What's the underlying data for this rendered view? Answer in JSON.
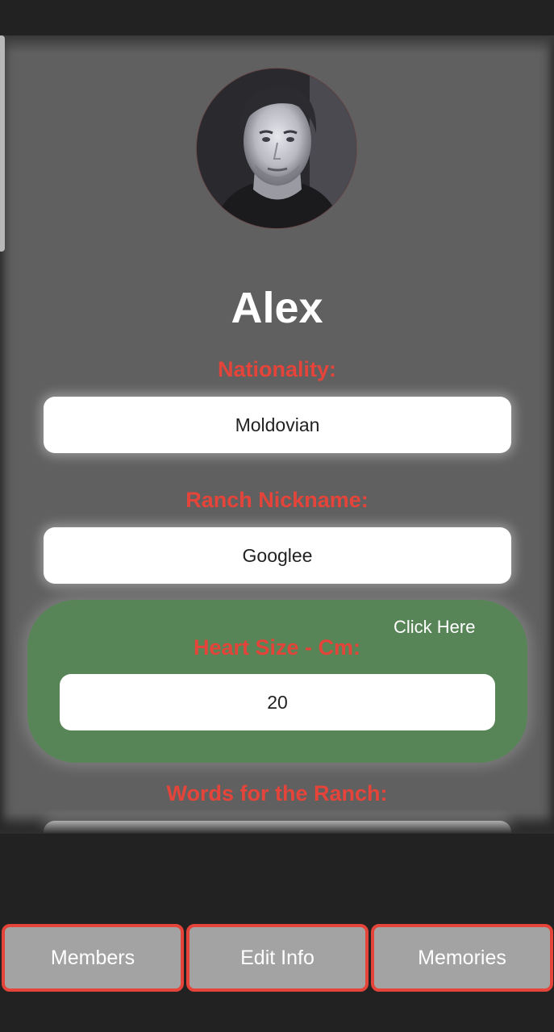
{
  "profile": {
    "name": "Alex",
    "avatar_alt": "profile-photo"
  },
  "fields": {
    "nationality": {
      "label": "Nationality:",
      "value": "Moldovian"
    },
    "ranch_nickname": {
      "label": "Ranch Nickname:",
      "value": "Googlee"
    },
    "heart_size": {
      "label": "Heart Size - Cm:",
      "value": "20",
      "action": "Click Here"
    },
    "words": {
      "label": "Words for the Ranch:",
      "value": ""
    }
  },
  "nav": {
    "members": "Members",
    "edit_info": "Edit Info",
    "memories": "Memories"
  },
  "colors": {
    "label_red": "#e5443a",
    "panel_green": "#578557",
    "content_bg": "#606060",
    "nav_button": "#a3a3a3"
  }
}
